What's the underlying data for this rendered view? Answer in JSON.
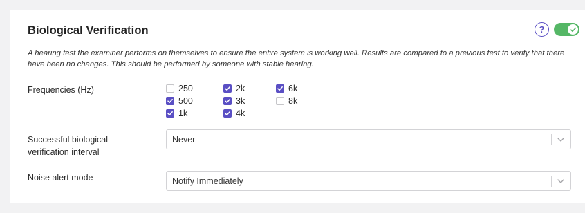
{
  "panel": {
    "title": "Biological Verification",
    "help_icon": "help-circle-icon",
    "help_glyph": "?",
    "toggle_enabled": true,
    "description": "A hearing test the examiner performs on themselves to ensure the entire system is working well. Results are compared to a previous test to verify that there have been no changes. This should be performed by someone with stable hearing."
  },
  "frequencies": {
    "label": "Frequencies (Hz)",
    "options": [
      {
        "label": "250",
        "checked": false
      },
      {
        "label": "500",
        "checked": true
      },
      {
        "label": "1k",
        "checked": true
      },
      {
        "label": "2k",
        "checked": true
      },
      {
        "label": "3k",
        "checked": true
      },
      {
        "label": "4k",
        "checked": true
      },
      {
        "label": "6k",
        "checked": true
      },
      {
        "label": "8k",
        "checked": false
      }
    ]
  },
  "interval": {
    "label": "Successful biological verification interval",
    "value": "Never"
  },
  "noise_alert": {
    "label": "Noise alert mode",
    "value": "Notify Immediately"
  },
  "colors": {
    "accent": "#5a4fc4",
    "toggle_on": "#55b766"
  }
}
